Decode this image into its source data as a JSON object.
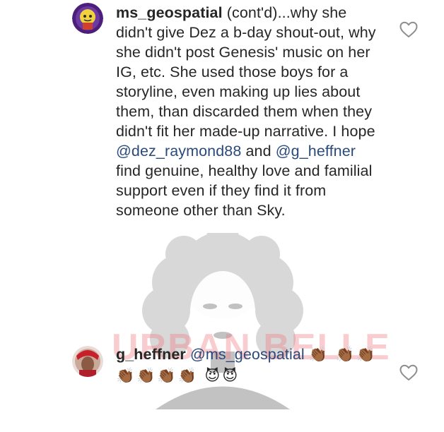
{
  "comments": [
    {
      "username": "ms_geospatial",
      "text_part1": "(cont'd)...why she didn't give Dez a b-day shout-out, why she didn't post Genesis' music on her IG, etc. She used those boys for a storyline, even making up lies about them, than discarded them when they didn't fit her made-up narrative. I hope",
      "mention1": "@dez_raymond88",
      "text_part2": "and",
      "mention2": "@g_heffner",
      "text_part3": "find genuine, healthy love and familial support even if they find it from someone other than Sky."
    },
    {
      "username": "g_heffner",
      "mention": "@ms_geospatial",
      "emojis": "👏🏾 👏🏾👏🏾👏🏾👏🏾👏🏾👏🏾 😈😈"
    }
  ],
  "watermark": {
    "text": "URBAN BELLE"
  },
  "icons": {
    "like": "heart-outline-icon",
    "watermark_art": "woman-silhouette-icon"
  },
  "colors": {
    "text": "#262626",
    "mention": "#2a4a7a",
    "heart_stroke": "#8e8e8e"
  }
}
